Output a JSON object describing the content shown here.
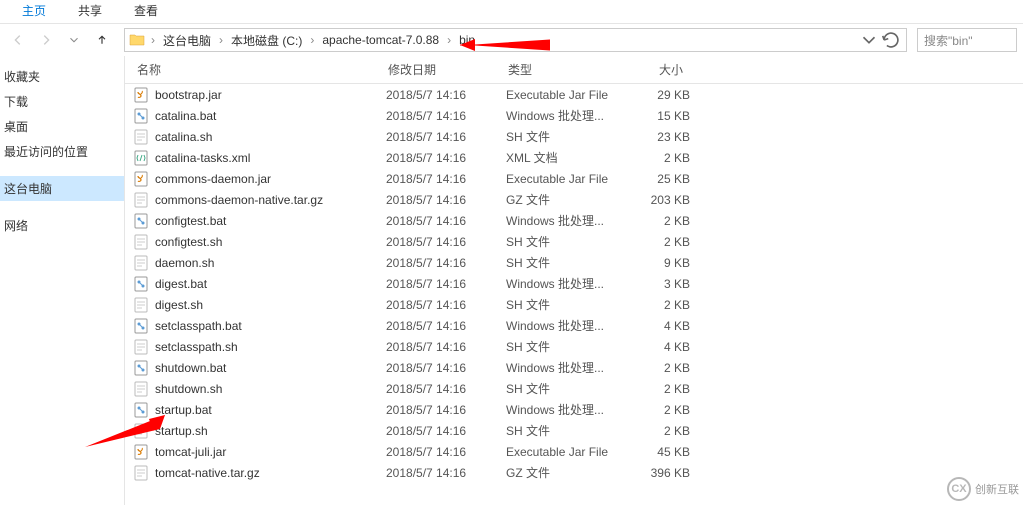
{
  "tabs": {
    "home": "主页",
    "share": "共享",
    "view": "查看"
  },
  "breadcrumb": {
    "items": [
      "这台电脑",
      "本地磁盘 (C:)",
      "apache-tomcat-7.0.88",
      "bin"
    ]
  },
  "search": {
    "placeholder": "搜索\"bin\""
  },
  "sidebar": {
    "favorites": "收藏夹",
    "downloads": "下载",
    "desktop": "桌面",
    "recent": "最近访问的位置",
    "thispc": "这台电脑",
    "network": "网络"
  },
  "columns": {
    "name": "名称",
    "date": "修改日期",
    "type": "类型",
    "size": "大小"
  },
  "files": [
    {
      "icon": "jar",
      "name": "bootstrap.jar",
      "date": "2018/5/7 14:16",
      "type": "Executable Jar File",
      "size": "29 KB"
    },
    {
      "icon": "bat",
      "name": "catalina.bat",
      "date": "2018/5/7 14:16",
      "type": "Windows 批处理...",
      "size": "15 KB"
    },
    {
      "icon": "file",
      "name": "catalina.sh",
      "date": "2018/5/7 14:16",
      "type": "SH 文件",
      "size": "23 KB"
    },
    {
      "icon": "xml",
      "name": "catalina-tasks.xml",
      "date": "2018/5/7 14:16",
      "type": "XML 文档",
      "size": "2 KB"
    },
    {
      "icon": "jar",
      "name": "commons-daemon.jar",
      "date": "2018/5/7 14:16",
      "type": "Executable Jar File",
      "size": "25 KB"
    },
    {
      "icon": "file",
      "name": "commons-daemon-native.tar.gz",
      "date": "2018/5/7 14:16",
      "type": "GZ 文件",
      "size": "203 KB"
    },
    {
      "icon": "bat",
      "name": "configtest.bat",
      "date": "2018/5/7 14:16",
      "type": "Windows 批处理...",
      "size": "2 KB"
    },
    {
      "icon": "file",
      "name": "configtest.sh",
      "date": "2018/5/7 14:16",
      "type": "SH 文件",
      "size": "2 KB"
    },
    {
      "icon": "file",
      "name": "daemon.sh",
      "date": "2018/5/7 14:16",
      "type": "SH 文件",
      "size": "9 KB"
    },
    {
      "icon": "bat",
      "name": "digest.bat",
      "date": "2018/5/7 14:16",
      "type": "Windows 批处理...",
      "size": "3 KB"
    },
    {
      "icon": "file",
      "name": "digest.sh",
      "date": "2018/5/7 14:16",
      "type": "SH 文件",
      "size": "2 KB"
    },
    {
      "icon": "bat",
      "name": "setclasspath.bat",
      "date": "2018/5/7 14:16",
      "type": "Windows 批处理...",
      "size": "4 KB"
    },
    {
      "icon": "file",
      "name": "setclasspath.sh",
      "date": "2018/5/7 14:16",
      "type": "SH 文件",
      "size": "4 KB"
    },
    {
      "icon": "bat",
      "name": "shutdown.bat",
      "date": "2018/5/7 14:16",
      "type": "Windows 批处理...",
      "size": "2 KB"
    },
    {
      "icon": "file",
      "name": "shutdown.sh",
      "date": "2018/5/7 14:16",
      "type": "SH 文件",
      "size": "2 KB"
    },
    {
      "icon": "bat",
      "name": "startup.bat",
      "date": "2018/5/7 14:16",
      "type": "Windows 批处理...",
      "size": "2 KB"
    },
    {
      "icon": "file",
      "name": "startup.sh",
      "date": "2018/5/7 14:16",
      "type": "SH 文件",
      "size": "2 KB"
    },
    {
      "icon": "jar",
      "name": "tomcat-juli.jar",
      "date": "2018/5/7 14:16",
      "type": "Executable Jar File",
      "size": "45 KB"
    },
    {
      "icon": "file",
      "name": "tomcat-native.tar.gz",
      "date": "2018/5/7 14:16",
      "type": "GZ 文件",
      "size": "396 KB"
    }
  ],
  "watermark": "创新互联"
}
